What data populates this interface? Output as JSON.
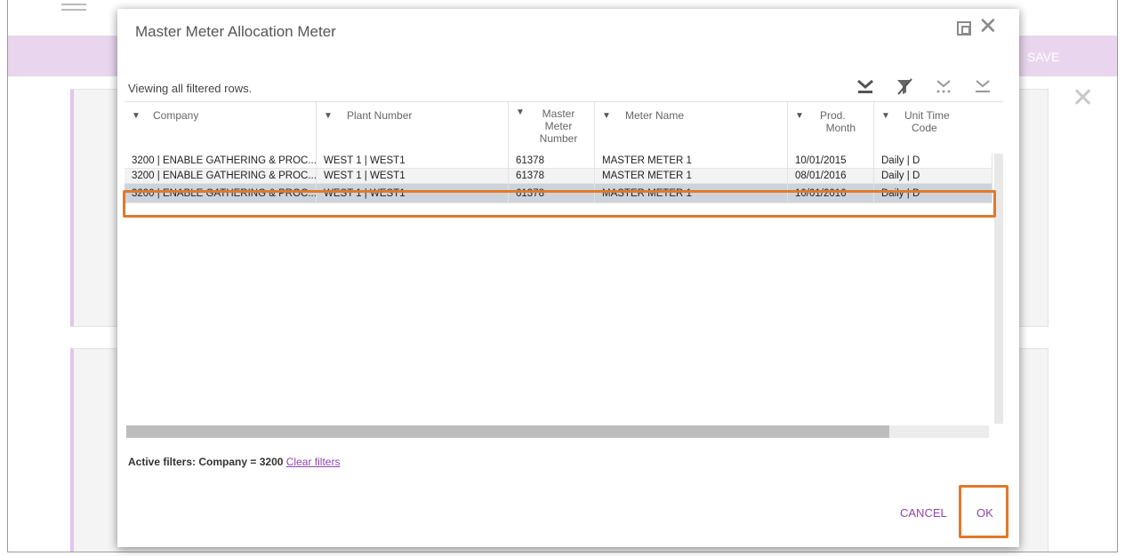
{
  "background": {
    "save_label": "SAVE"
  },
  "modal": {
    "title": "Master Meter Allocation Meter",
    "viewing_text": "Viewing all filtered rows.",
    "columns": [
      {
        "label_lines": [
          "Company"
        ]
      },
      {
        "label_lines": [
          "Plant Number"
        ]
      },
      {
        "label_lines": [
          "Master",
          "Meter",
          "Number"
        ]
      },
      {
        "label_lines": [
          "Meter Name"
        ]
      },
      {
        "label_lines": [
          "Prod.",
          "Month"
        ]
      },
      {
        "label_lines": [
          "Unit Time",
          "Code"
        ]
      }
    ],
    "rows": [
      [
        "3200 | ENABLE GATHERING & PROC...",
        "WEST 1 | WEST1",
        "61378",
        "MASTER METER 1",
        "10/01/2015",
        "Daily | D"
      ],
      [
        "3200 | ENABLE GATHERING & PROC...",
        "WEST 1 | WEST1",
        "61378",
        "MASTER METER 1",
        "08/01/2016",
        "Daily | D"
      ],
      [
        "3200 | ENABLE GATHERING & PROC...",
        "WEST 1 | WEST1",
        "61378",
        "MASTER METER 1",
        "10/01/2016",
        "Daily | D"
      ]
    ],
    "selected_row_index": 2,
    "active_filters_label": "Active filters:",
    "active_filters_value": "Company = 3200",
    "clear_filters_label": "Clear filters",
    "cancel_label": "CANCEL",
    "ok_label": "OK"
  },
  "colors": {
    "accent": "#8e44ad",
    "highlight_outline": "#e0792a",
    "selected_row": "#cdd3da"
  }
}
